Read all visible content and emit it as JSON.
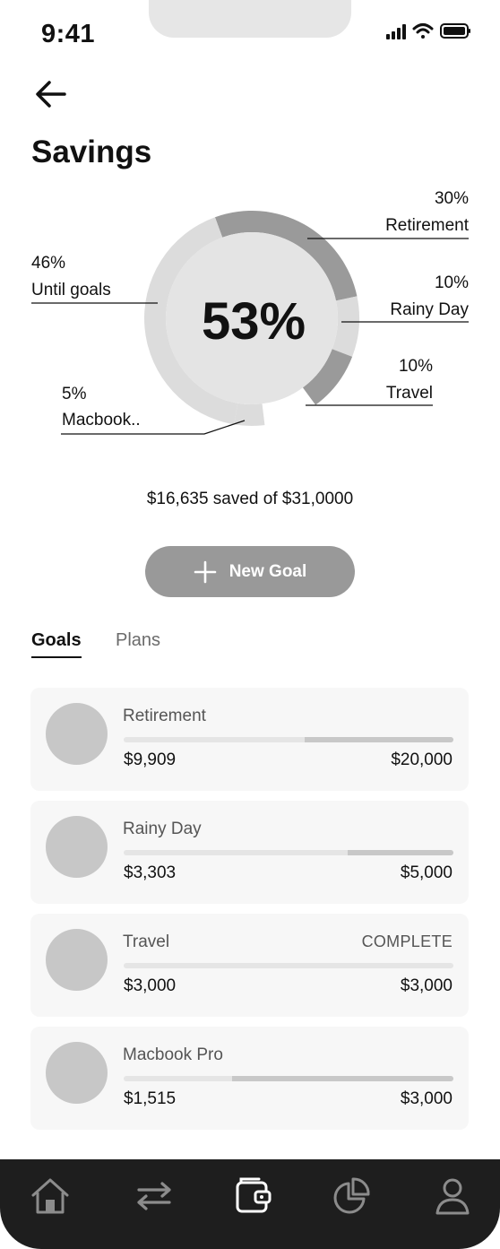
{
  "status_bar": {
    "time": "9:41"
  },
  "header": {
    "title": "Savings"
  },
  "chart_data": {
    "type": "donut",
    "center_value": "53%",
    "segments": [
      {
        "label": "Retirement",
        "percent": "30%",
        "value": 30
      },
      {
        "label": "Rainy Day",
        "percent": "10%",
        "value": 10
      },
      {
        "label": "Travel",
        "percent": "10%",
        "value": 10
      },
      {
        "label": "Macbook..",
        "percent": "5%",
        "value": 5
      },
      {
        "label": "Until goals",
        "percent": "46%",
        "value": 46
      }
    ]
  },
  "summary": "$16,635 saved of $31,0000",
  "new_goal_label": "New Goal",
  "tabs": {
    "goals": "Goals",
    "plans": "Plans"
  },
  "goals": [
    {
      "name": "Retirement",
      "status": "",
      "saved": "$9,909",
      "target": "$20,000",
      "progress": 0.45
    },
    {
      "name": "Rainy Day",
      "status": "",
      "saved": "$3,303",
      "target": "$5,000",
      "progress": 0.32
    },
    {
      "name": "Travel",
      "status": "COMPLETE",
      "saved": "$3,000",
      "target": "$3,000",
      "progress": 0.0
    },
    {
      "name": "Macbook Pro",
      "status": "",
      "saved": "$1,515",
      "target": "$3,000",
      "progress": 0.67
    }
  ],
  "colors": {
    "accent": "#999999",
    "ring_dark": "#9a9a9a",
    "ring_light": "#dcdcdc",
    "nav_bg": "#1e1e1e"
  },
  "nav": [
    "home-icon",
    "transfer-icon",
    "wallet-icon",
    "pie-chart-icon",
    "profile-icon"
  ]
}
